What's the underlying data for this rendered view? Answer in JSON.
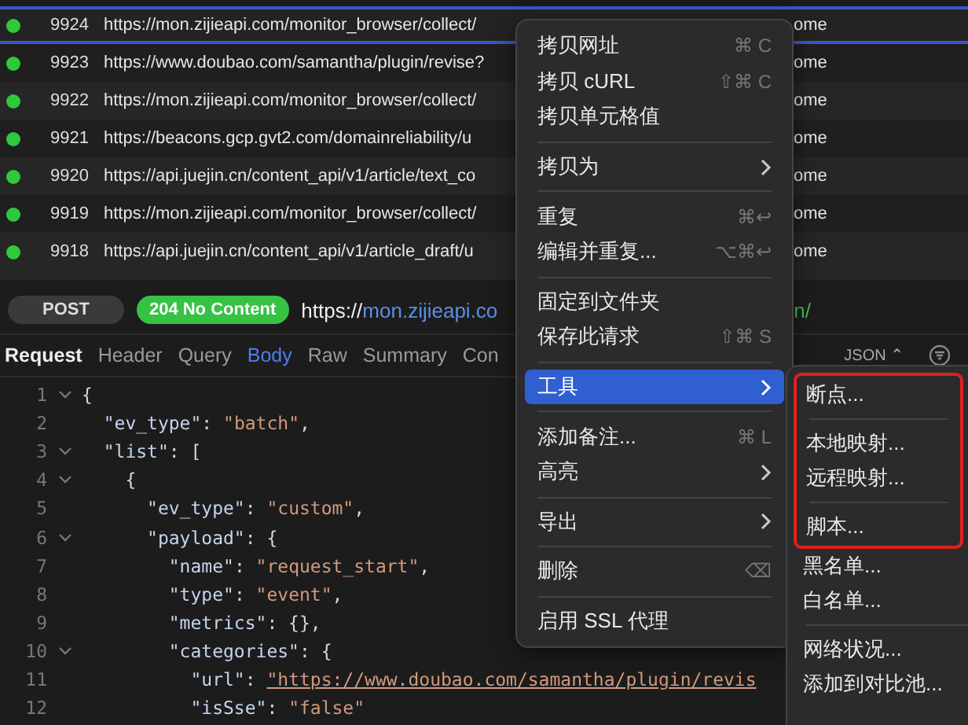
{
  "requests": [
    {
      "id": "9924",
      "url": "https://mon.zijieapi.com/monitor_browser/collect/",
      "client": "ome",
      "selected": true
    },
    {
      "id": "9923",
      "url": "https://www.doubao.com/samantha/plugin/revise?",
      "client": "ome",
      "selected": false
    },
    {
      "id": "9922",
      "url": "https://mon.zijieapi.com/monitor_browser/collect/",
      "client": "ome",
      "selected": false
    },
    {
      "id": "9921",
      "url": "https://beacons.gcp.gvt2.com/domainreliability/u",
      "client": "ome",
      "selected": false
    },
    {
      "id": "9920",
      "url": "https://api.juejin.cn/content_api/v1/article/text_co",
      "client": "ome",
      "selected": false
    },
    {
      "id": "9919",
      "url": "https://mon.zijieapi.com/monitor_browser/collect/",
      "client": "ome",
      "selected": false
    },
    {
      "id": "9918",
      "url": "https://api.juejin.cn/content_api/v1/article_draft/u",
      "client": "ome",
      "selected": false
    }
  ],
  "detail": {
    "method": "POST",
    "status": "204 No Content",
    "url_scheme": "https://",
    "url_host": "mon.zijieapi.co",
    "url_tail": "n/",
    "tabs": [
      {
        "label": "Request",
        "kind": "title"
      },
      {
        "label": "Header",
        "kind": "tab",
        "selected": false
      },
      {
        "label": "Query",
        "kind": "tab",
        "selected": false
      },
      {
        "label": "Body",
        "kind": "tab",
        "selected": true
      },
      {
        "label": "Raw",
        "kind": "tab",
        "selected": false
      },
      {
        "label": "Summary",
        "kind": "tab",
        "selected": false
      },
      {
        "label": "Con",
        "kind": "tab",
        "selected": false
      }
    ],
    "format": "JSON ⌃",
    "code": [
      {
        "n": "1",
        "fold": true,
        "tokens": [
          {
            "kind": "punct",
            "text": "{"
          }
        ]
      },
      {
        "n": "2",
        "fold": false,
        "tokens": [
          {
            "kind": "key",
            "text": "  \"ev_type\""
          },
          {
            "kind": "punct",
            "text": ": "
          },
          {
            "kind": "str",
            "text": "\"batch\""
          },
          {
            "kind": "punct",
            "text": ","
          }
        ]
      },
      {
        "n": "3",
        "fold": true,
        "tokens": [
          {
            "kind": "key",
            "text": "  \"list\""
          },
          {
            "kind": "punct",
            "text": ": ["
          }
        ]
      },
      {
        "n": "4",
        "fold": true,
        "tokens": [
          {
            "kind": "punct",
            "text": "    {"
          }
        ]
      },
      {
        "n": "5",
        "fold": false,
        "tokens": [
          {
            "kind": "key",
            "text": "      \"ev_type\""
          },
          {
            "kind": "punct",
            "text": ": "
          },
          {
            "kind": "str",
            "text": "\"custom\""
          },
          {
            "kind": "punct",
            "text": ","
          }
        ]
      },
      {
        "n": "6",
        "fold": true,
        "tokens": [
          {
            "kind": "key",
            "text": "      \"payload\""
          },
          {
            "kind": "punct",
            "text": ": {"
          }
        ]
      },
      {
        "n": "7",
        "fold": false,
        "tokens": [
          {
            "kind": "key",
            "text": "        \"name\""
          },
          {
            "kind": "punct",
            "text": ": "
          },
          {
            "kind": "str",
            "text": "\"request_start\""
          },
          {
            "kind": "punct",
            "text": ","
          }
        ]
      },
      {
        "n": "8",
        "fold": false,
        "tokens": [
          {
            "kind": "key",
            "text": "        \"type\""
          },
          {
            "kind": "punct",
            "text": ": "
          },
          {
            "kind": "str",
            "text": "\"event\""
          },
          {
            "kind": "punct",
            "text": ","
          }
        ]
      },
      {
        "n": "9",
        "fold": false,
        "tokens": [
          {
            "kind": "key",
            "text": "        \"metrics\""
          },
          {
            "kind": "punct",
            "text": ": {},"
          }
        ]
      },
      {
        "n": "10",
        "fold": true,
        "tokens": [
          {
            "kind": "key",
            "text": "        \"categories\""
          },
          {
            "kind": "punct",
            "text": ": {"
          }
        ]
      },
      {
        "n": "11",
        "fold": false,
        "tokens": [
          {
            "kind": "key",
            "text": "          \"url\""
          },
          {
            "kind": "punct",
            "text": ": "
          },
          {
            "kind": "link",
            "text": "\"https://www.doubao.com/samantha/plugin/revis"
          }
        ]
      },
      {
        "n": "12",
        "fold": false,
        "tokens": [
          {
            "kind": "key",
            "text": "          \"isSse\""
          },
          {
            "kind": "punct",
            "text": ": "
          },
          {
            "kind": "str",
            "text": "\"false\""
          }
        ]
      }
    ]
  },
  "context_menu": {
    "groups": [
      [
        {
          "label": "拷贝网址",
          "shortcut": "⌘ C",
          "submenu": false,
          "selected": false
        },
        {
          "label": "拷贝 cURL",
          "shortcut": "⇧⌘ C",
          "submenu": false,
          "selected": false
        },
        {
          "label": "拷贝单元格值",
          "submenu": false,
          "selected": false
        }
      ],
      [
        {
          "label": "拷贝为",
          "submenu": true,
          "selected": false
        }
      ],
      [
        {
          "label": "重复",
          "shortcut": "⌘↩",
          "submenu": false,
          "selected": false
        },
        {
          "label": "编辑并重复...",
          "shortcut": "⌥⌘↩",
          "submenu": false,
          "selected": false
        }
      ],
      [
        {
          "label": "固定到文件夹",
          "submenu": false,
          "selected": false
        },
        {
          "label": "保存此请求",
          "shortcut": "⇧⌘ S",
          "submenu": false,
          "selected": false
        }
      ],
      [
        {
          "label": "工具",
          "submenu": true,
          "selected": true
        }
      ],
      [
        {
          "label": "添加备注...",
          "shortcut": "⌘ L",
          "submenu": false,
          "selected": false
        },
        {
          "label": "高亮",
          "submenu": true,
          "selected": false
        }
      ],
      [
        {
          "label": "导出",
          "submenu": true,
          "selected": false
        }
      ],
      [
        {
          "label": "删除",
          "shortcut": "⌫",
          "submenu": false,
          "selected": false
        }
      ],
      [
        {
          "label": "启用 SSL 代理",
          "submenu": false,
          "selected": false
        }
      ]
    ]
  },
  "tools_submenu": {
    "outlined_groups": [
      [
        "断点..."
      ],
      [
        "本地映射...",
        "远程映射..."
      ],
      [
        "脚本..."
      ]
    ],
    "other_groups": [
      [
        "黑名单...",
        "白名单..."
      ],
      [
        "网络状况...",
        "添加到对比池..."
      ]
    ]
  }
}
